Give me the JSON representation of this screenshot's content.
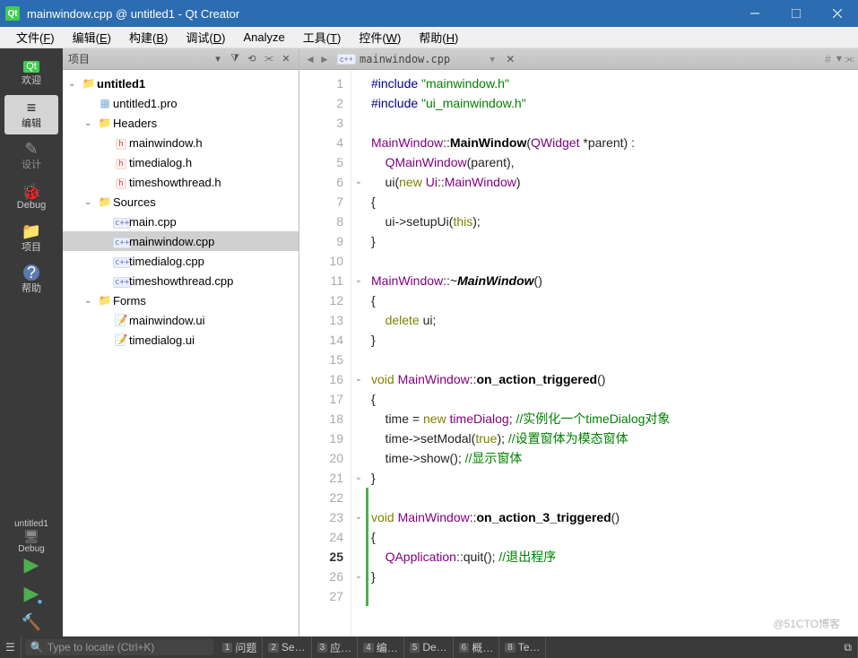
{
  "window": {
    "title": "mainwindow.cpp @ untitled1 - Qt Creator"
  },
  "menu": {
    "items": [
      "文件(F)",
      "编辑(E)",
      "构建(B)",
      "调试(D)",
      "Analyze",
      "工具(T)",
      "控件(W)",
      "帮助(H)"
    ]
  },
  "sidebar": {
    "items": [
      {
        "label": "欢迎",
        "icon": "Qt"
      },
      {
        "label": "编辑",
        "icon": "≡"
      },
      {
        "label": "设计",
        "icon": "✎"
      },
      {
        "label": "Debug",
        "icon": "🐞"
      },
      {
        "label": "项目",
        "icon": "📁"
      },
      {
        "label": "帮助",
        "icon": "?"
      }
    ],
    "target": {
      "project": "untitled1",
      "config": "Debug"
    }
  },
  "projectPanel": {
    "title": "项目",
    "tree": [
      {
        "level": 0,
        "expand": true,
        "icon": "folder-y",
        "label": "untitled1",
        "bold": true
      },
      {
        "level": 1,
        "expand": null,
        "icon": "file-pro",
        "label": "untitled1.pro"
      },
      {
        "level": 1,
        "expand": true,
        "icon": "folder-y",
        "label": "Headers"
      },
      {
        "level": 2,
        "expand": null,
        "icon": "file-h",
        "label": "mainwindow.h"
      },
      {
        "level": 2,
        "expand": null,
        "icon": "file-h",
        "label": "timedialog.h"
      },
      {
        "level": 2,
        "expand": null,
        "icon": "file-h",
        "label": "timeshowthread.h"
      },
      {
        "level": 1,
        "expand": true,
        "icon": "folder-y",
        "label": "Sources"
      },
      {
        "level": 2,
        "expand": null,
        "icon": "file-cpp",
        "label": "main.cpp"
      },
      {
        "level": 2,
        "expand": null,
        "icon": "file-cpp",
        "label": "mainwindow.cpp",
        "selected": true
      },
      {
        "level": 2,
        "expand": null,
        "icon": "file-cpp",
        "label": "timedialog.cpp"
      },
      {
        "level": 2,
        "expand": null,
        "icon": "file-cpp",
        "label": "timeshowthread.cpp"
      },
      {
        "level": 1,
        "expand": true,
        "icon": "folder-y",
        "label": "Forms"
      },
      {
        "level": 2,
        "expand": null,
        "icon": "file-ui",
        "label": "mainwindow.ui"
      },
      {
        "level": 2,
        "expand": null,
        "icon": "file-ui",
        "label": "timedialog.ui"
      }
    ]
  },
  "editor": {
    "tab": {
      "icon": "c++",
      "name": "mainwindow.cpp"
    },
    "rightInfo": "#",
    "foldLines": [
      6,
      11,
      16,
      21,
      23,
      26
    ],
    "currentLine": 25,
    "barStart": 22,
    "barEnd": 27,
    "lines": [
      {
        "html": "<span class='pp'>#include</span> <span class='str'>\"mainwindow.h\"</span>"
      },
      {
        "html": "<span class='pp'>#include</span> <span class='str'>\"ui_mainwindow.h\"</span>"
      },
      {
        "html": ""
      },
      {
        "html": "<span class='type'>MainWindow</span>::<span class='fn'>MainWindow</span>(<span class='type'>QWidget</span> *parent) :"
      },
      {
        "html": "    <span class='type'>QMainWindow</span>(parent),"
      },
      {
        "html": "    ui(<span class='kw'>new</span> <span class='type'>Ui</span>::<span class='type'>MainWindow</span>)"
      },
      {
        "html": "{"
      },
      {
        "html": "    ui-&gt;setupUi(<span class='this'>this</span>);"
      },
      {
        "html": "}"
      },
      {
        "html": ""
      },
      {
        "html": "<span class='type'>MainWindow</span>::~<span class='fn' style='font-style:italic'>MainWindow</span>()"
      },
      {
        "html": "{"
      },
      {
        "html": "    <span class='kw'>delete</span> ui;"
      },
      {
        "html": "}"
      },
      {
        "html": ""
      },
      {
        "html": "<span class='kw'>void</span> <span class='type'>MainWindow</span>::<span class='fn'>on_action_triggered</span>()"
      },
      {
        "html": "{"
      },
      {
        "html": "    time = <span class='kw'>new</span> <span class='type'>timeDialog</span>; <span class='cmt'>//实例化一个timeDialog对象</span>"
      },
      {
        "html": "    time-&gt;setModal(<span class='bool'>true</span>); <span class='cmt'>//设置窗体为模态窗体</span>"
      },
      {
        "html": "    time-&gt;show(); <span class='cmt'>//显示窗体</span>"
      },
      {
        "html": "}"
      },
      {
        "html": ""
      },
      {
        "html": "<span class='kw'>void</span> <span class='type'>MainWindow</span>::<span class='fn'>on_action_3_triggered</span>()"
      },
      {
        "html": "{"
      },
      {
        "html": "    <span class='type'>QApplication</span>::quit(); <span class='cmt'>//退出程序</span>"
      },
      {
        "html": "}"
      },
      {
        "html": ""
      }
    ]
  },
  "statusbar": {
    "locatePlaceholder": "Type to locate (Ctrl+K)",
    "items": [
      {
        "n": "1",
        "t": "问题"
      },
      {
        "n": "2",
        "t": "Se…"
      },
      {
        "n": "3",
        "t": "应…"
      },
      {
        "n": "4",
        "t": "编…"
      },
      {
        "n": "5",
        "t": "De…"
      },
      {
        "n": "6",
        "t": "概…"
      },
      {
        "n": "8",
        "t": "Te…"
      }
    ]
  },
  "watermark": "@51CTO博客"
}
